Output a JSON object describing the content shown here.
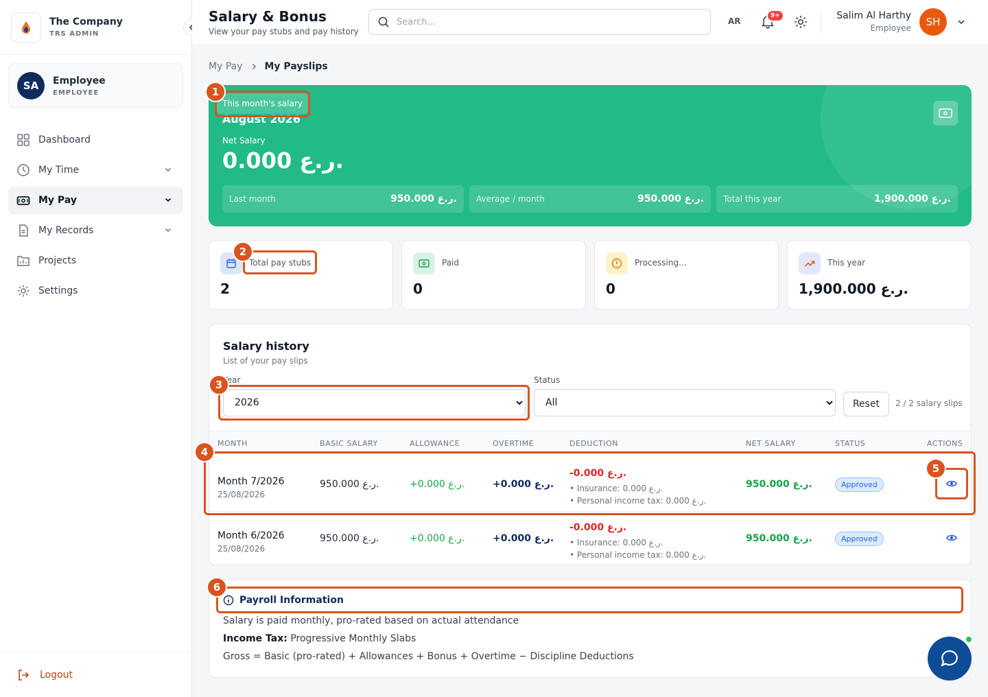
{
  "brand": {
    "name": "The Company",
    "sub": "TRS ADMIN"
  },
  "user_card": {
    "initials": "SA",
    "name": "Employee",
    "role": "EMPLOYEE"
  },
  "nav": [
    {
      "label": "Dashboard",
      "icon": "grid-icon",
      "chevron": false,
      "active": false
    },
    {
      "label": "My Time",
      "icon": "clock-icon",
      "chevron": true,
      "active": false
    },
    {
      "label": "My Pay",
      "icon": "wallet-icon",
      "chevron": true,
      "active": true
    },
    {
      "label": "My Records",
      "icon": "document-icon",
      "chevron": true,
      "active": false
    },
    {
      "label": "Projects",
      "icon": "folder-icon",
      "chevron": false,
      "active": false
    },
    {
      "label": "Settings",
      "icon": "gear-icon",
      "chevron": false,
      "active": false
    }
  ],
  "logout_label": "Logout",
  "header": {
    "title": "Salary & Bonus",
    "subtitle": "View your pay stubs and pay history",
    "search_placeholder": "Search...",
    "lang": "AR",
    "notif_badge": "9+",
    "user_name": "Salim Al Harthy",
    "user_role": "Employee",
    "user_initials": "SH"
  },
  "breadcrumb": {
    "parent": "My Pay",
    "current": "My Payslips"
  },
  "hero": {
    "pill": "This month's salary",
    "month": "August 2026",
    "net_label": "Net Salary",
    "net_value": "0.000 ر.ع.",
    "stats": [
      {
        "label": "Last month",
        "value": "950.000 ر.ع."
      },
      {
        "label": "Average / month",
        "value": "950.000 ر.ع."
      },
      {
        "label": "Total this year",
        "value": "1,900.000 ر.ع."
      }
    ]
  },
  "stat_cards": [
    {
      "label": "Total pay stubs",
      "value": "2",
      "icon": "calendar-icon",
      "bg": "#dbe6fb",
      "fg": "#2563eb"
    },
    {
      "label": "Paid",
      "value": "0",
      "icon": "cash-icon",
      "bg": "#d8f3e6",
      "fg": "#16a34a"
    },
    {
      "label": "Processing...",
      "value": "0",
      "icon": "alert-circle-icon",
      "bg": "#fdf2c8",
      "fg": "#d97706"
    },
    {
      "label": "This year",
      "value": "1,900.000 ر.ع.",
      "icon": "trending-up-icon",
      "bg": "#e0e7ff",
      "fg": "#ea580c"
    }
  ],
  "history": {
    "title": "Salary history",
    "subtitle": "List of your pay slips",
    "year_label": "Year",
    "year_value": "2026",
    "status_label": "Status",
    "status_value": "All",
    "reset_label": "Reset",
    "count": "2 / 2 salary slips",
    "columns": [
      "MONTH",
      "BASIC SALARY",
      "ALLOWANCE",
      "OVERTIME",
      "DEDUCTION",
      "NET SALARY",
      "STATUS",
      "ACTIONS"
    ],
    "rows": [
      {
        "month": "Month 7/2026",
        "date": "25/08/2026",
        "basic": "950.000 ر.ع.",
        "allowance": "+0.000 ر.ع.",
        "overtime": "+0.000 ر.ع.",
        "deduction": "-0.000 ر.ع.",
        "insurance": "• Insurance: 0.000 ر.ع.",
        "tax": "• Personal income tax: 0.000 ر.ع.",
        "net": "950.000 ر.ع.",
        "status": "Approved"
      },
      {
        "month": "Month 6/2026",
        "date": "25/08/2026",
        "basic": "950.000 ر.ع.",
        "allowance": "+0.000 ر.ع.",
        "overtime": "+0.000 ر.ع.",
        "deduction": "-0.000 ر.ع.",
        "insurance": "• Insurance: 0.000 ر.ع.",
        "tax": "• Personal income tax: 0.000 ر.ع.",
        "net": "950.000 ر.ع.",
        "status": "Approved"
      }
    ]
  },
  "payroll_info": {
    "title": "Payroll Information",
    "line1": "Salary is paid monthly, pro-rated based on actual attendance",
    "tax_label": "Income Tax:",
    "tax_value": "Progressive Monthly Slabs",
    "formula": "Gross = Basic (pro-rated) + Allowances + Bonus + Overtime − Discipline Deductions"
  },
  "annotations": [
    "1",
    "2",
    "3",
    "4",
    "5",
    "6"
  ],
  "colors": {
    "accent": "#22bb88",
    "annotation": "#d9541e",
    "navy": "#0f2c5c",
    "orange": "#ea580c"
  }
}
